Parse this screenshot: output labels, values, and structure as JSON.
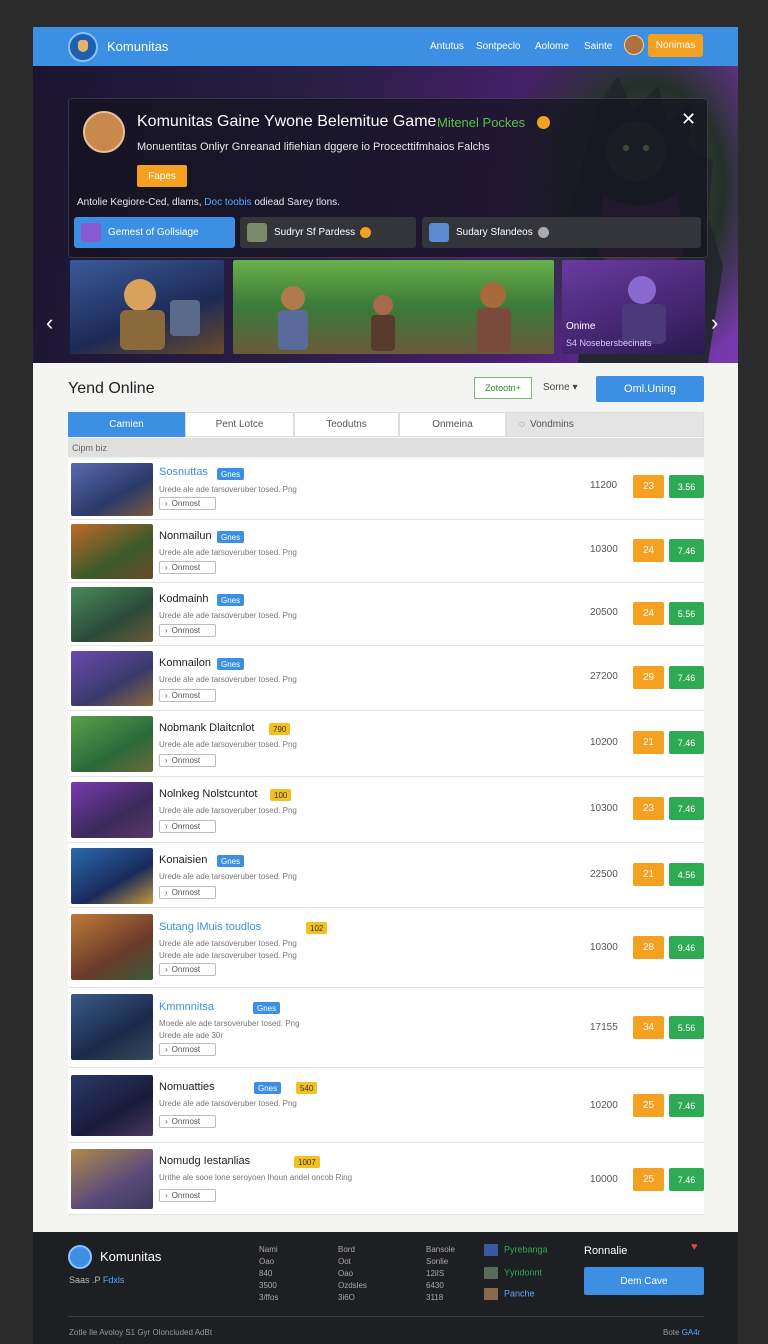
{
  "topbar": {
    "brand": "Komunitas",
    "nav": [
      "Antutus",
      "Sontpeclo",
      "Aolome",
      "Sainte"
    ],
    "nav_button": "Nonimas"
  },
  "hero": {
    "title": "Komunitas Gaine Ywone Belemitue Game",
    "tag": "Mitenel Pockes",
    "subtitle": "Monuentitas Onliyr Gnreanad lifiehian dggere io Procecttifmhaios Falchs",
    "button": "Fapes",
    "note_pre": "Antolie Kegiore-Ced, dlams,",
    "note_hl": "Doc toobis",
    "note_post": "odiead Sarey tlons.",
    "tabs": [
      "Gemest of Gollsiage",
      "Sudryr Sf Pardess",
      "Sudary Sfandeos"
    ],
    "thumb_label": "Onime",
    "thumb_sub": "S4 Nosebersbecinats"
  },
  "list_section": {
    "title": "Yend Online",
    "chip": "Zotootn+",
    "sort": "Sorne",
    "button": "Oml.Uning",
    "tabs": [
      "Camien",
      "Pent Lotce",
      "Teodutns",
      "Onmeina",
      "Vondmins"
    ],
    "subheader": "Cipm biz"
  },
  "games": [
    {
      "name": "Sosnuttas",
      "badge": "Gnes",
      "desc": "Urede ale ade tarsoveruber tosed. Png",
      "btn": "Onrnost",
      "num": "11200",
      "a": "23",
      "b": "3.56"
    },
    {
      "name": "Nonmailun",
      "badge": "Gnes",
      "desc": "Urede ale ade tarsoveruber tosed. Png",
      "btn": "Onrnost",
      "num": "10300",
      "a": "24",
      "b": "7.46"
    },
    {
      "name": "Kodmainh",
      "badge": "Gnes",
      "desc": "Urede ale ade tarsoveruber tosed. Png",
      "btn": "Onrnost",
      "num": "20500",
      "a": "24",
      "b": "5.56"
    },
    {
      "name": "Komnailon",
      "badge": "Gnes",
      "desc": "Urede ale ade tarsoveruber tosed. Png",
      "btn": "Onrnost",
      "num": "27200",
      "a": "29",
      "b": "7.46"
    },
    {
      "name": "Nobmank Dlaitcnlot",
      "badge": "790",
      "desc": "Urede ale ade tarsoveruber tosed. Png",
      "btn": "Onrnost",
      "num": "10200",
      "a": "21",
      "b": "7.46"
    },
    {
      "name": "Nolnkeg Nolstcuntot",
      "badge": "100",
      "desc": "Urede ale ade tarsoveruber tosed. Png",
      "btn": "Onrnost",
      "num": "10300",
      "a": "23",
      "b": "7.46"
    },
    {
      "name": "Konaisien",
      "badge": "Gnes",
      "desc": "Urede ale ade tarsoveruber tosed. Png",
      "btn": "Onrnost",
      "num": "22500",
      "a": "21",
      "b": "4.56"
    },
    {
      "name": "Sutang lMuis toudlos",
      "badge": "102",
      "desc": "Urede ale ade tarsoveruber tosed. Png",
      "desc2": "Urede ale ade tarsoveruber tosed. Png",
      "btn": "Onrnost",
      "num": "10300",
      "a": "28",
      "b": "9.46"
    },
    {
      "name": "Kmmnnitsa",
      "badge": "Gnes",
      "desc": "Moede ale ade tarsoveruber tosed. Png",
      "desc2": "Urede ale ade 30r",
      "btn": "Onrnost",
      "num": "17155",
      "a": "34",
      "b": "5.56"
    },
    {
      "name": "Nomuatties",
      "badge": "Gnes",
      "badge2": "540",
      "desc": "Urede ale ade tarsoveruber tosed. Png",
      "btn": "Onrnost",
      "num": "10200",
      "a": "25",
      "b": "7.46"
    },
    {
      "name": "Nomudg Iestanlias",
      "badge": "1007",
      "desc": "Urithe ale sooe lone seroyoen Ihoun andel oncob Ring",
      "btn": "Onrnost",
      "num": "10000",
      "a": "25",
      "b": "7.46"
    }
  ],
  "footer": {
    "brand": "Komunitas",
    "sub_pre": "Saas .P",
    "sub_hl": "Fdxls",
    "col1": [
      "Nami",
      "Oao",
      "840",
      "3500",
      "3/ffos"
    ],
    "col2": [
      "Bord",
      "Oot",
      "Oao",
      "Ozdsles",
      "3i6O"
    ],
    "col3": [
      "Bansole",
      "Sonlie",
      "12iIS",
      "6430",
      "3118"
    ],
    "side": [
      "Pyrebanga",
      "Yyndonnt",
      "Panche"
    ],
    "side_colors": [
      "#2eaa55",
      "#2eaa55",
      "#5aa8ff"
    ],
    "cta_title": "Ronnalie",
    "cta_button": "Dem Cave",
    "copyright": "Zotle Ile Avoloy  S1 Gyr Olonciuded AdBt",
    "right_pre": "Bote",
    "right_hl": "GA4r"
  },
  "colors": {
    "accent": "#3d8fe3",
    "orange": "#f4a020",
    "green": "#2eaa55"
  }
}
